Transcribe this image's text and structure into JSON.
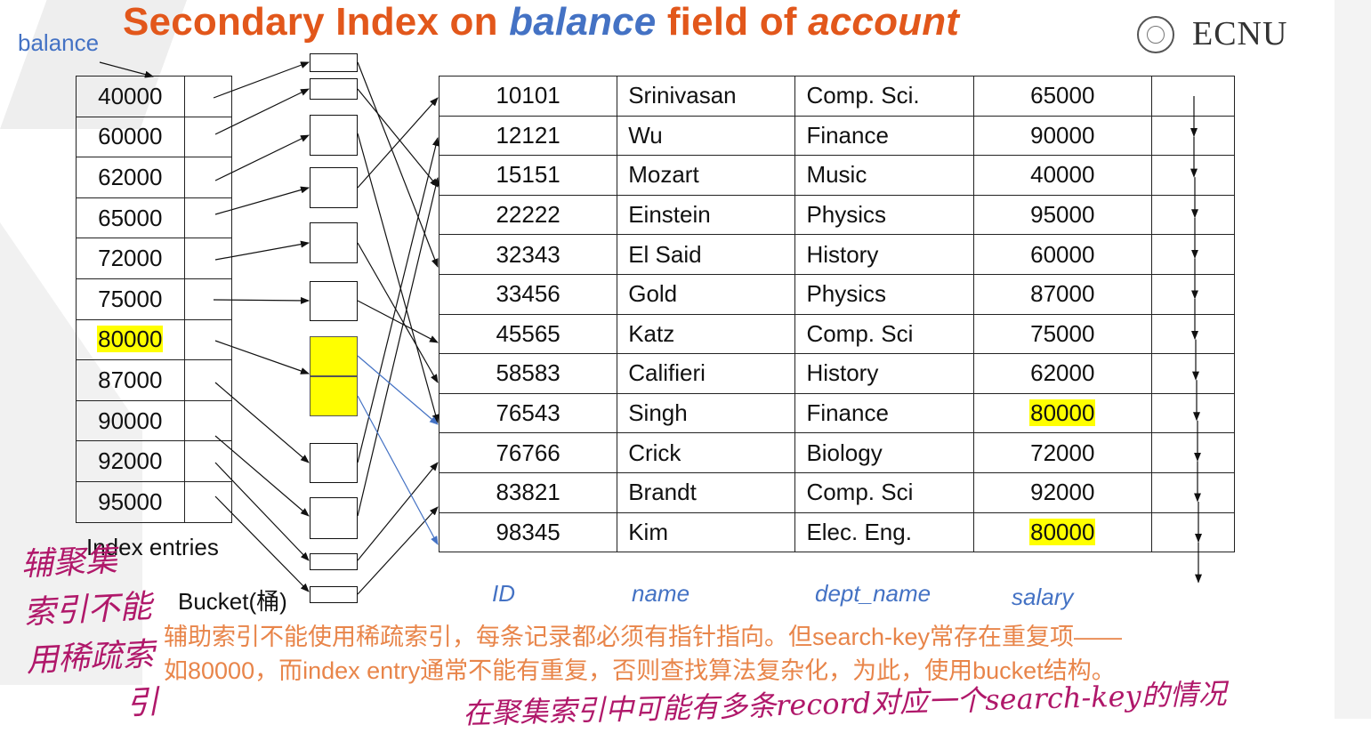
{
  "slide": {
    "title_prefix": "Secondary Index on ",
    "title_field": "balance",
    "title_middle": " field of ",
    "title_relation": "account",
    "logo_text": "ECNU"
  },
  "labels": {
    "balance": "balance",
    "index_entries": "Index entries",
    "bucket": "Bucket(桶)"
  },
  "index_keys": [
    "40000",
    "60000",
    "62000",
    "65000",
    "72000",
    "75000",
    "80000",
    "87000",
    "90000",
    "92000",
    "95000"
  ],
  "highlighted_key": "80000",
  "records": [
    {
      "id": "10101",
      "name": "Srinivasan",
      "dept": "Comp. Sci.",
      "salary": "65000"
    },
    {
      "id": "12121",
      "name": "Wu",
      "dept": "Finance",
      "salary": "90000"
    },
    {
      "id": "15151",
      "name": "Mozart",
      "dept": "Music",
      "salary": "40000"
    },
    {
      "id": "22222",
      "name": "Einstein",
      "dept": "Physics",
      "salary": "95000"
    },
    {
      "id": "32343",
      "name": "El Said",
      "dept": "History",
      "salary": "60000"
    },
    {
      "id": "33456",
      "name": "Gold",
      "dept": "Physics",
      "salary": "87000"
    },
    {
      "id": "45565",
      "name": "Katz",
      "dept": "Comp. Sci",
      "salary": "75000"
    },
    {
      "id": "58583",
      "name": "Califieri",
      "dept": "History",
      "salary": "62000"
    },
    {
      "id": "76543",
      "name": "Singh",
      "dept": "Finance",
      "salary": "80000"
    },
    {
      "id": "76766",
      "name": "Crick",
      "dept": "Biology",
      "salary": "72000"
    },
    {
      "id": "83821",
      "name": "Brandt",
      "dept": "Comp. Sci",
      "salary": "92000"
    },
    {
      "id": "98345",
      "name": "Kim",
      "dept": "Elec. Eng.",
      "salary": "80000"
    }
  ],
  "columns": {
    "id": "ID",
    "name": "name",
    "dept": "dept_name",
    "salary": "salary"
  },
  "note_text": "辅助索引不能使用稀疏索引，每条记录都必须有指针指向。但search-key常存在重复项——如80000，而index entry通常不能有重复，否则查找算法复杂化，为此，使用bucket结构。",
  "handwriting": {
    "left_lines": [
      "辅聚集",
      "索引不能",
      "用稀疏索",
      "引"
    ],
    "bottom": "在聚集索引中可能有多条record对应一个search-key的情况"
  },
  "colors": {
    "title": "#e2571b",
    "accent_blue": "#4472c4",
    "highlight": "#ffff00",
    "note": "#e8854a",
    "handwriting": "#b0186a"
  }
}
